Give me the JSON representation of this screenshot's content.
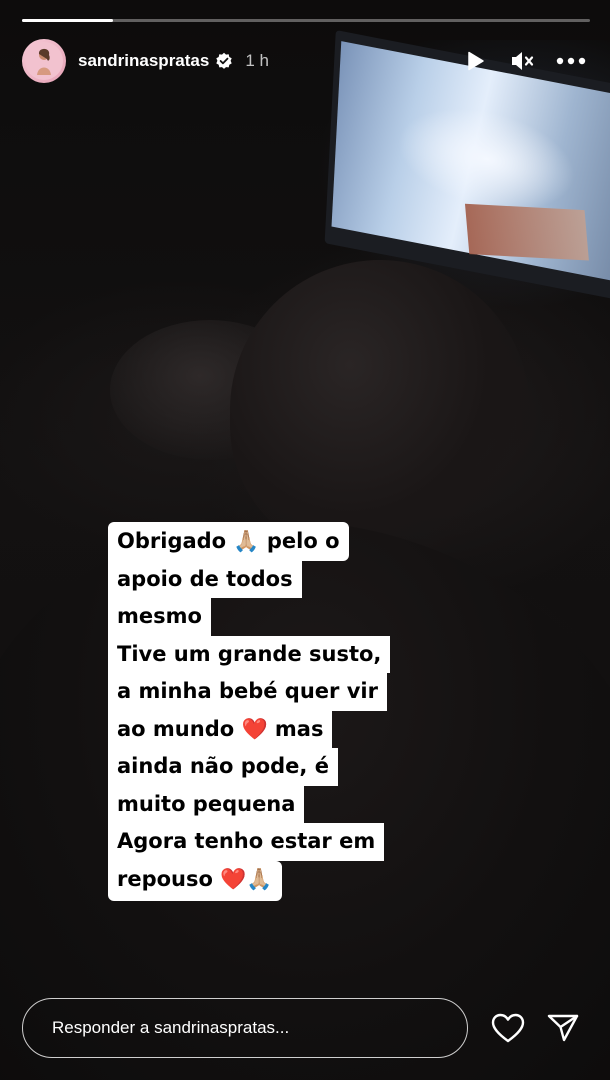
{
  "story": {
    "username": "sandrinaspratas",
    "timestamp": "1 h",
    "verified": true,
    "progress_fraction": 0.16
  },
  "controls": {
    "play_icon": "play-icon",
    "mute_icon": "speaker-muted-icon",
    "more_icon": "more-horizontal-icon"
  },
  "caption": {
    "lines": [
      "Obrigado 🙏🏼 pelo o",
      "apoio de todos",
      "mesmo",
      "Tive um grande susto,",
      "a minha bebé quer vir",
      "ao mundo ❤️ mas",
      "ainda não pode, é",
      "muito pequena",
      "Agora tenho estar em",
      "repouso ❤️🙏🏼"
    ]
  },
  "reply": {
    "placeholder": "Responder a sandrinaspratas..."
  },
  "colors": {
    "text": "#ffffff",
    "sticker_bg": "#ffffff",
    "sticker_text": "#000000",
    "verified_badge": "#ffffff"
  }
}
